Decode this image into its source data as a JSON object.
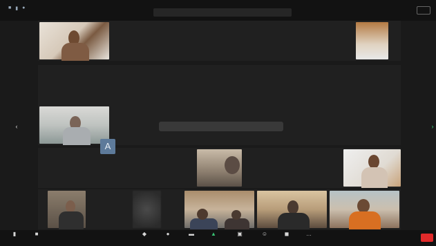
{
  "topbar": {
    "meeting_info": "",
    "view_label": ""
  },
  "tiles": [
    {
      "name": "",
      "tag": ""
    },
    {
      "name": "",
      "tag": ""
    },
    {
      "name": "",
      "tag": ""
    },
    {
      "name": "",
      "tag": ""
    },
    {
      "name": "",
      "tag": ""
    },
    {
      "name": "",
      "tag": ""
    },
    {
      "name": "",
      "tag": ""
    },
    {
      "name": "",
      "tag": ""
    },
    {
      "name": "",
      "tag": ""
    },
    {
      "name": "",
      "tag": ""
    },
    {
      "name": "",
      "tag": ""
    },
    {
      "name": "",
      "tag": ""
    },
    {
      "name": "",
      "tag": ""
    },
    {
      "name": "",
      "tag": ""
    },
    {
      "name": "",
      "tag": ""
    },
    {
      "name": "",
      "tag": ""
    },
    {
      "name": "",
      "tag": ""
    },
    {
      "name": "",
      "tag": ""
    },
    {
      "name": "",
      "tag": ""
    },
    {
      "name": "",
      "tag": ""
    },
    {
      "name": "",
      "tag": ""
    },
    {
      "name": "",
      "tag": ""
    },
    {
      "name": "",
      "tag": ""
    },
    {
      "name": "",
      "tag": ""
    },
    {
      "name": "",
      "tag": ""
    }
  ],
  "avatar_letter": "A",
  "toast": "",
  "toolbar": {
    "items": [
      {
        "icon": "microphone-icon",
        "label": ""
      },
      {
        "icon": "video-camera-icon",
        "label": ""
      },
      {
        "icon": "shield-icon",
        "label": ""
      },
      {
        "icon": "participants-icon",
        "label": ""
      },
      {
        "icon": "chat-icon",
        "label": ""
      },
      {
        "icon": "share-screen-icon",
        "label": ""
      },
      {
        "icon": "record-icon",
        "label": ""
      },
      {
        "icon": "reactions-icon",
        "label": ""
      },
      {
        "icon": "apps-icon",
        "label": ""
      },
      {
        "icon": "more-icon",
        "label": ""
      }
    ],
    "end_label": ""
  }
}
